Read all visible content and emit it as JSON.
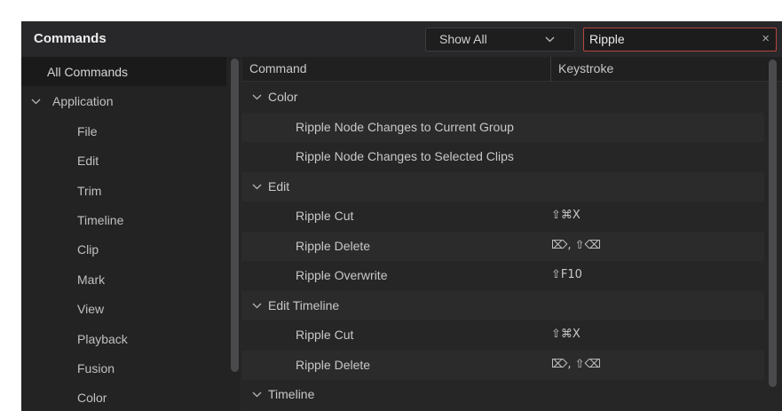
{
  "header": {
    "title": "Commands",
    "filter_label": "Show All",
    "search_value": "Ripple",
    "clear_glyph": "×"
  },
  "sidebar": {
    "items": [
      {
        "label": "All Commands",
        "level": 0,
        "selected": true
      },
      {
        "label": "Application",
        "level": 1,
        "expanded": true
      },
      {
        "label": "File",
        "level": 2
      },
      {
        "label": "Edit",
        "level": 2
      },
      {
        "label": "Trim",
        "level": 2
      },
      {
        "label": "Timeline",
        "level": 2
      },
      {
        "label": "Clip",
        "level": 2
      },
      {
        "label": "Mark",
        "level": 2
      },
      {
        "label": "View",
        "level": 2
      },
      {
        "label": "Playback",
        "level": 2
      },
      {
        "label": "Fusion",
        "level": 2
      },
      {
        "label": "Color",
        "level": 2
      }
    ]
  },
  "table": {
    "columns": [
      "Command",
      "Keystroke"
    ],
    "rows": [
      {
        "type": "group",
        "label": "Color"
      },
      {
        "type": "cmd",
        "command": "Ripple Node Changes to Current Group",
        "keystroke": ""
      },
      {
        "type": "cmd",
        "command": "Ripple Node Changes to Selected Clips",
        "keystroke": ""
      },
      {
        "type": "group",
        "label": "Edit"
      },
      {
        "type": "cmd",
        "command": "Ripple Cut",
        "keystroke": "⇧⌘X"
      },
      {
        "type": "cmd",
        "command": "Ripple Delete",
        "keystroke": "⌦, ⇧⌫"
      },
      {
        "type": "cmd",
        "command": "Ripple Overwrite",
        "keystroke": "⇧F10"
      },
      {
        "type": "group",
        "label": "Edit Timeline"
      },
      {
        "type": "cmd",
        "command": "Ripple Cut",
        "keystroke": "⇧⌘X"
      },
      {
        "type": "cmd",
        "command": "Ripple Delete",
        "keystroke": "⌦, ⇧⌫"
      },
      {
        "type": "group",
        "label": "Timeline"
      }
    ]
  },
  "icons": {
    "filter_dropdown": "chevron-down-icon",
    "search_clear": "close-icon",
    "tree_expander": "chevron-down-icon"
  },
  "colors": {
    "panel_bg": "#282829",
    "search_border": "#b9463f",
    "selected_row": "#1a1a1b"
  }
}
